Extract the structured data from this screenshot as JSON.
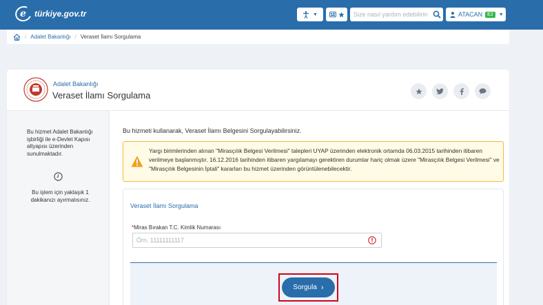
{
  "header": {
    "logo_text": "türkiye.gov.tr",
    "access_icon": "accessibility-icon",
    "lang_icon": "language-star-icon",
    "search_placeholder": "Size nasıl yardım edebilirim?",
    "user_name": "ATACAN",
    "badge": "E2"
  },
  "breadcrumb": {
    "parent": "Adalet Bakanlığı",
    "current": "Veraset İlamı Sorgulama"
  },
  "service": {
    "institution": "Adalet Bakanlığı",
    "title": "Veraset İlamı Sorgulama"
  },
  "sidebar": {
    "info": "Bu hizmet Adalet Bakanlığı işbirliği ile e-Devlet Kapısı altyapısı üzerinden sunulmaktadır.",
    "time": "Bu işlem için yaklaşık 1 dakikanızı ayırmalısınız."
  },
  "main": {
    "intro": "Bu hizmeti kullanarak, Veraset İlamı Belgesini Sorgulayabilirsiniz.",
    "warning": "Yargı birimlerinden alınan \"Mirasçılık Belgesi Verilmesi\" talepleri UYAP üzerinden elektronik ortamda 06.03.2015 tarihinden itibaren verilmeye başlanmıştır. 16.12.2016 tarihinden itibaren yargılamayı gerektiren durumlar hariç olmak üzere \"Mirasçılık Belgesi Verilmesi\" ve \"Mirasçılık Belgesinin İptali\" kararları bu hizmet üzerinden görüntülenebilecektir."
  },
  "form": {
    "title": "Veraset İlamı Sorgulama",
    "required_mark": "*",
    "field_label": "Miras Bırakan T.C. Kimlik Numarası",
    "field_placeholder": "Örn. 11111111117",
    "submit_label": "Sorgula",
    "submit_chevron": "›"
  },
  "colors": {
    "brand": "#2a6dab",
    "warning_border": "#f4b740",
    "highlight": "#d0021b"
  }
}
